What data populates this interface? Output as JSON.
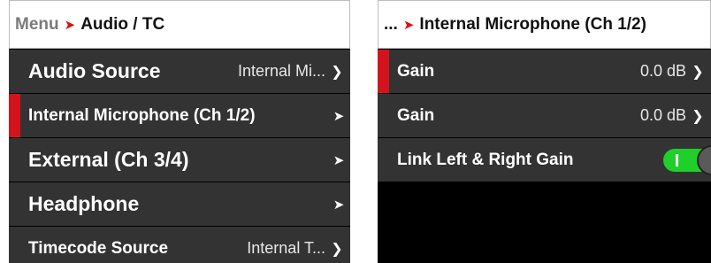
{
  "left_panel": {
    "breadcrumb": {
      "root": "Menu",
      "separator": "➤",
      "current": "Audio / TC"
    },
    "rows": [
      {
        "label": "Audio Source",
        "value": "Internal Mi...",
        "icon": "chevron-down-icon"
      },
      {
        "label": "Internal Microphone (Ch 1/2)",
        "icon": "arrow-right-icon",
        "selected": true
      },
      {
        "label": "External (Ch 3/4)",
        "icon": "arrow-right-icon"
      },
      {
        "label": "Headphone",
        "icon": "arrow-right-icon"
      },
      {
        "label": "Timecode Source",
        "value": "Internal T...",
        "icon": "chevron-down-icon"
      }
    ]
  },
  "right_panel": {
    "breadcrumb": {
      "root": "...",
      "separator": "➤",
      "current": "Internal Microphone (Ch 1/2)"
    },
    "rows": [
      {
        "label": "Gain",
        "value": "0.0 dB",
        "icon": "chevron-down-icon",
        "selected": true
      },
      {
        "label": "Gain",
        "value": "0.0 dB",
        "icon": "chevron-down-icon"
      },
      {
        "label": "Link Left & Right Gain",
        "toggle_on": true
      }
    ]
  },
  "colors": {
    "accent": "#d4141c",
    "toggle_on": "#1fcf2a",
    "row_bg": "#333333"
  }
}
